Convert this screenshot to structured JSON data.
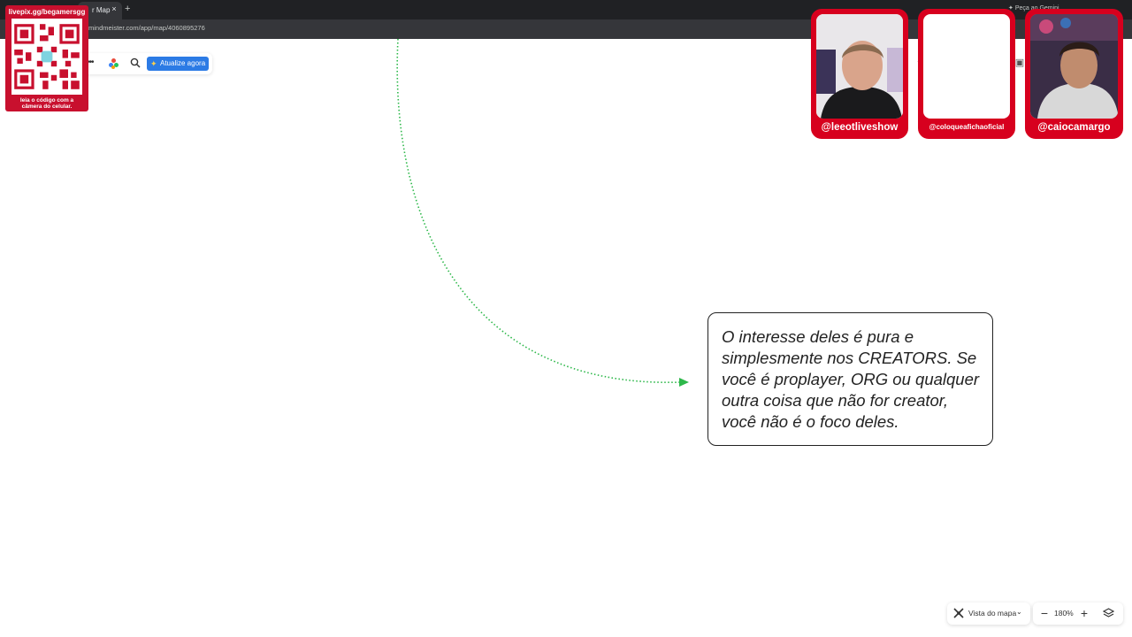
{
  "browser": {
    "tab_title": "r Map",
    "tab_close": "×",
    "new_tab": "+",
    "url": "mindmeister.com/app/map/4060895276",
    "gemini_label": "Peça ao Gemini"
  },
  "toolbar_left": {
    "upgrade_label": "Atualize agora"
  },
  "qr_overlay": {
    "title": "livepix.gg/begamersgg",
    "caption_line1": "leia o código com a",
    "caption_line2": "câmera do celular."
  },
  "node": {
    "text": "O interesse deles é pura e simplesmente nos CREATORS. Se você é proplayer, ORG ou qualquer outra coisa que não for creator, você não é o foco deles."
  },
  "webcams": [
    {
      "handle": "@leeotliveshow"
    },
    {
      "handle": "@coloqueafichaoficial"
    },
    {
      "handle": "@caiocamargo"
    }
  ],
  "bottom_controls": {
    "map_view_label": "Vista do mapa",
    "zoom_level": "180%",
    "zoom_minus": "−",
    "zoom_plus": "+"
  },
  "colors": {
    "overlay_red": "#d7001e",
    "connector_green": "#2db84a",
    "upgrade_blue": "#2c7be5"
  }
}
